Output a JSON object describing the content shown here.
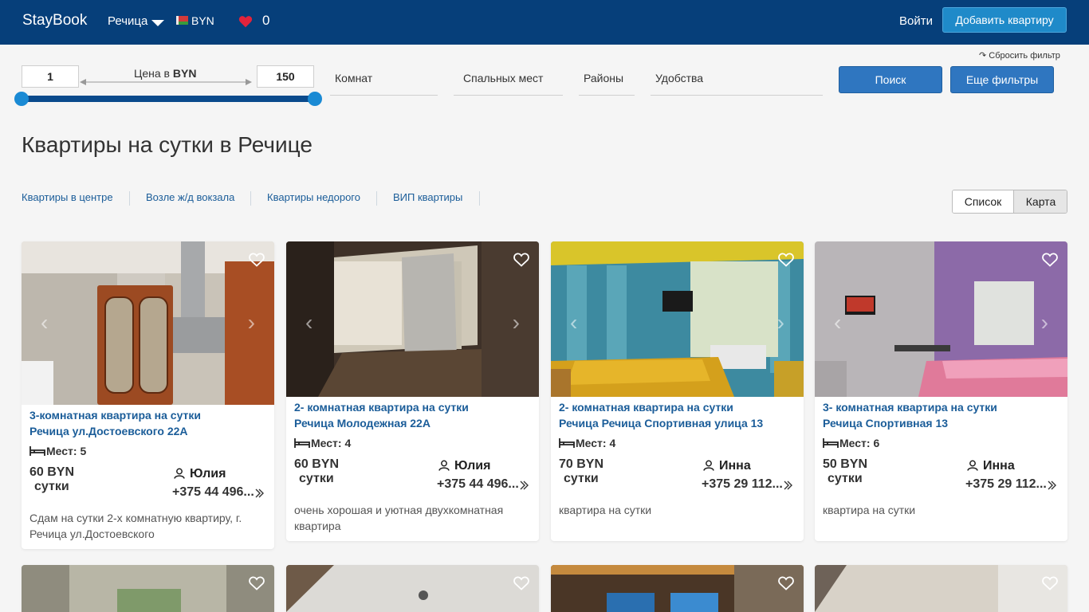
{
  "header": {
    "brand": "StayBook",
    "city": "Речица",
    "currency": "BYN",
    "favorites_count": "0",
    "login": "Войти",
    "add_apartment": "Добавить квартиру"
  },
  "filters": {
    "reset": "↷ Сбросить фильтр",
    "price_min": "1",
    "price_max": "150",
    "price_label_prefix": "Цена в ",
    "price_label_currency": "BYN",
    "rooms": "Комнат",
    "beds": "Спальных мест",
    "districts": "Районы",
    "amenities": "Удобства",
    "search": "Поиск",
    "more_filters": "Еще фильтры"
  },
  "page_title": "Квартиры на сутки в Речице",
  "quick_links": [
    "Квартиры в центре",
    "Возле ж/д вокзала",
    "Квартиры недорого",
    "ВИП квартиры"
  ],
  "view_toggle": {
    "list": "Список",
    "map": "Карта"
  },
  "listings": [
    {
      "title_line1": "3-комнатная квартира на сутки",
      "title_line2": "Речица ул.Достоевского 22А",
      "places": "Мест: 5",
      "price": "60 BYN",
      "per": "сутки",
      "owner": "Юлия",
      "phone": "+375 44 496...",
      "description": "Сдам на сутки 2-х комнатную квартиру, г. Речица ул.Достоевского"
    },
    {
      "title_line1": "2- комнатная квартира на сутки",
      "title_line2": "Речица Молодежная 22А",
      "places": "Мест: 4",
      "price": "60 BYN",
      "per": "сутки",
      "owner": "Юлия",
      "phone": "+375 44 496...",
      "description": "очень хорошая и уютная двухкомнатная квартира"
    },
    {
      "title_line1": "2- комнатная квартира на сутки",
      "title_line2": "Речица Речица Спортивная улица 13",
      "places": "Мест: 4",
      "price": "70 BYN",
      "per": "сутки",
      "owner": "Инна",
      "phone": "+375 29 112...",
      "description": "квартира на сутки"
    },
    {
      "title_line1": "3- комнатная квартира на сутки",
      "title_line2": "Речица Спортивная 13",
      "places": "Мест: 6",
      "price": "50 BYN",
      "per": "сутки",
      "owner": "Инна",
      "phone": "+375 29 112...",
      "description": "квартира на сутки"
    }
  ],
  "colors": {
    "header_bg": "#063f7a",
    "accent": "#1f8ac9",
    "link": "#1b5d99",
    "button": "#2f76c0"
  },
  "icons": [
    "heart-icon",
    "caret-down-icon",
    "flag-icon",
    "bed-icon",
    "user-icon",
    "chevron-right-icon",
    "arrow-left-icon",
    "arrow-right-icon"
  ]
}
